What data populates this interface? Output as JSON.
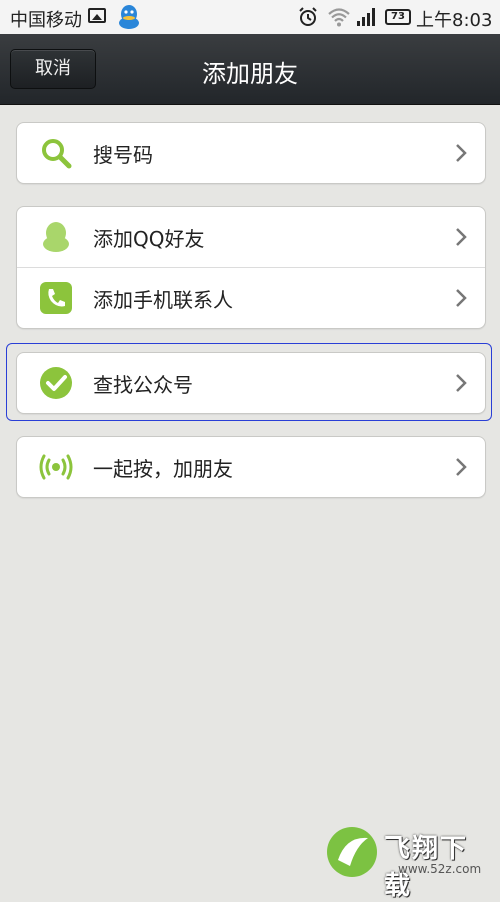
{
  "status_bar": {
    "carrier": "中国移动",
    "battery": "73",
    "time": "上午8:03",
    "icons": [
      "image-icon",
      "qq-icon",
      "alarm-icon",
      "wifi-icon",
      "signal-icon",
      "battery-icon"
    ]
  },
  "title_bar": {
    "cancel_label": "取消",
    "title": "添加朋友"
  },
  "sections": [
    {
      "items": [
        {
          "label": "搜号码",
          "icon": "search-icon"
        }
      ]
    },
    {
      "items": [
        {
          "label": "添加QQ好友",
          "icon": "qq-icon"
        },
        {
          "label": "添加手机联系人",
          "icon": "phone-icon"
        }
      ]
    },
    {
      "items": [
        {
          "label": "查找公众号",
          "icon": "check-icon"
        }
      ]
    },
    {
      "items": [
        {
          "label": "一起按，加朋友",
          "icon": "radar-icon"
        }
      ]
    }
  ],
  "colors": {
    "accent_green": "#8cc43c",
    "title_bar": "#2b2f33",
    "highlight": "#2a3fd6"
  },
  "watermark": {
    "brand": "飞翔下载",
    "url": "www.52z.com"
  }
}
